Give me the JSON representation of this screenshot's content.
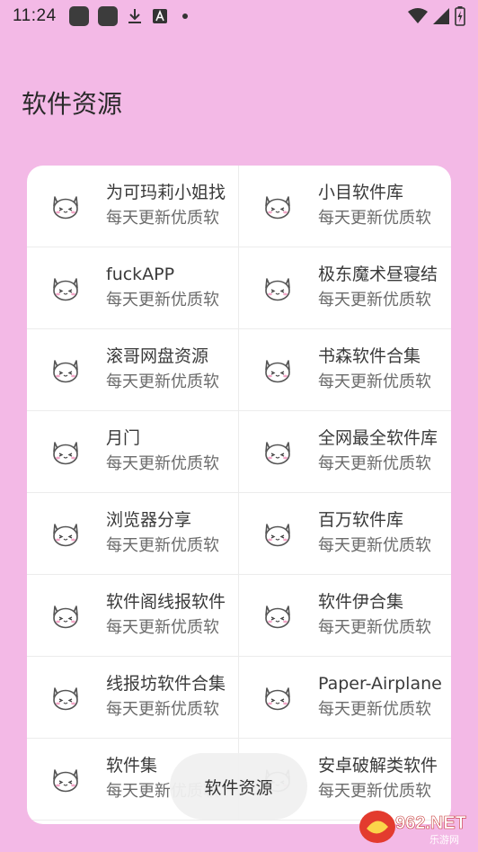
{
  "status_bar": {
    "time": "11:24"
  },
  "page": {
    "title": "软件资源"
  },
  "items": [
    {
      "title": "为可玛莉小姐找",
      "subtitle": "每天更新优质软"
    },
    {
      "title": "小目软件库",
      "subtitle": "每天更新优质软"
    },
    {
      "title": "fuckAPP",
      "subtitle": "每天更新优质软"
    },
    {
      "title": "极东魔术昼寝结",
      "subtitle": "每天更新优质软"
    },
    {
      "title": "滚哥网盘资源",
      "subtitle": "每天更新优质软"
    },
    {
      "title": "书森软件合集",
      "subtitle": "每天更新优质软"
    },
    {
      "title": "月门",
      "subtitle": "每天更新优质软"
    },
    {
      "title": "全网最全软件库",
      "subtitle": "每天更新优质软"
    },
    {
      "title": "浏览器分享",
      "subtitle": "每天更新优质软"
    },
    {
      "title": "百万软件库",
      "subtitle": "每天更新优质软"
    },
    {
      "title": "软件阁线报软件",
      "subtitle": "每天更新优质软"
    },
    {
      "title": "软件伊合集",
      "subtitle": "每天更新优质软"
    },
    {
      "title": "线报坊软件合集",
      "subtitle": "每天更新优质软"
    },
    {
      "title": "Paper-Airplane",
      "subtitle": "每天更新优质软"
    },
    {
      "title": "软件集",
      "subtitle": "每天更新优质软"
    },
    {
      "title": "安卓破解类软件",
      "subtitle": "每天更新优质软"
    }
  ],
  "toast": {
    "text": "软件资源"
  },
  "watermark": {
    "brand": "962.NET",
    "sub": "乐游网"
  },
  "colors": {
    "background": "#f3b9e6",
    "card": "#ffffff"
  },
  "icons": {
    "item_icon": "cat-face-icon"
  }
}
